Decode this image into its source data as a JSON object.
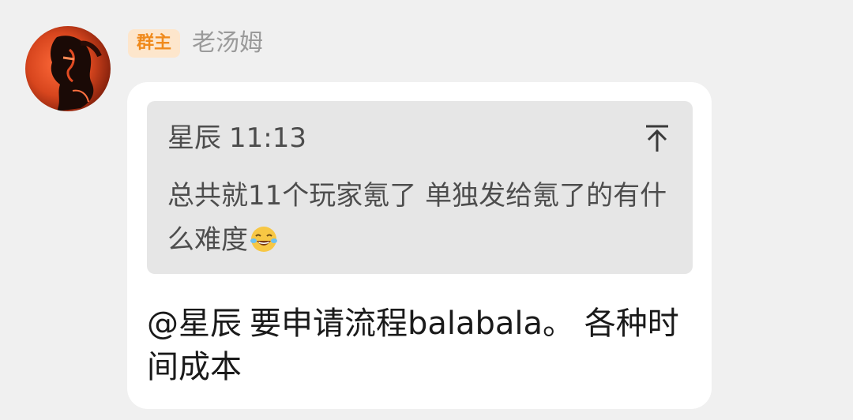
{
  "sender": {
    "role_badge": "群主",
    "name": "老汤姆",
    "avatar_icon": "avatar-portrait"
  },
  "quote": {
    "author": "星辰",
    "time": "11:13",
    "text": "总共就11个玩家氪了  单独发给氪了的有什么难度",
    "emoji_icon": "laughing-with-tears-emoji",
    "jump_icon": "jump-to-top-arrow-icon"
  },
  "message": {
    "mention": "@星辰",
    "text": "要申请流程balabala。 各种时间成本"
  },
  "colors": {
    "badge_bg": "#fde6cc",
    "badge_text": "#f08a1c",
    "background": "#f0f0f0",
    "bubble": "#ffffff",
    "quote_bg": "#e6e6e6"
  }
}
